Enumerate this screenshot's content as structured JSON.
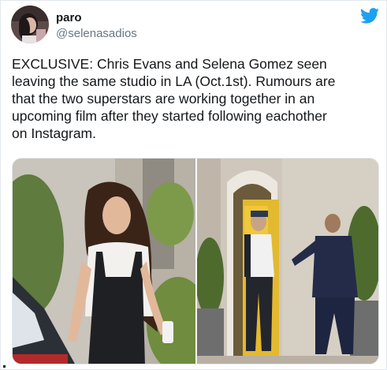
{
  "tweet": {
    "author": {
      "display_name": "paro",
      "handle": "@selenasadios",
      "avatar_icon": "profile-avatar"
    },
    "brand_icon": "twitter-bird-icon",
    "brand_color": "#1da1f2",
    "text_lines": [
      "EXCLUSIVE: Chris Evans and Selena Gomez seen",
      "leaving the same studio in LA (Oct.1st). Rumours are",
      "that the two superstars are working together in an",
      "upcoming film after they started following eachother",
      "on Instagram."
    ],
    "media": {
      "count": 2,
      "photos": [
        {
          "icon": "photo-woman-in-overalls"
        },
        {
          "icon": "photo-men-at-studio-door"
        }
      ]
    }
  }
}
